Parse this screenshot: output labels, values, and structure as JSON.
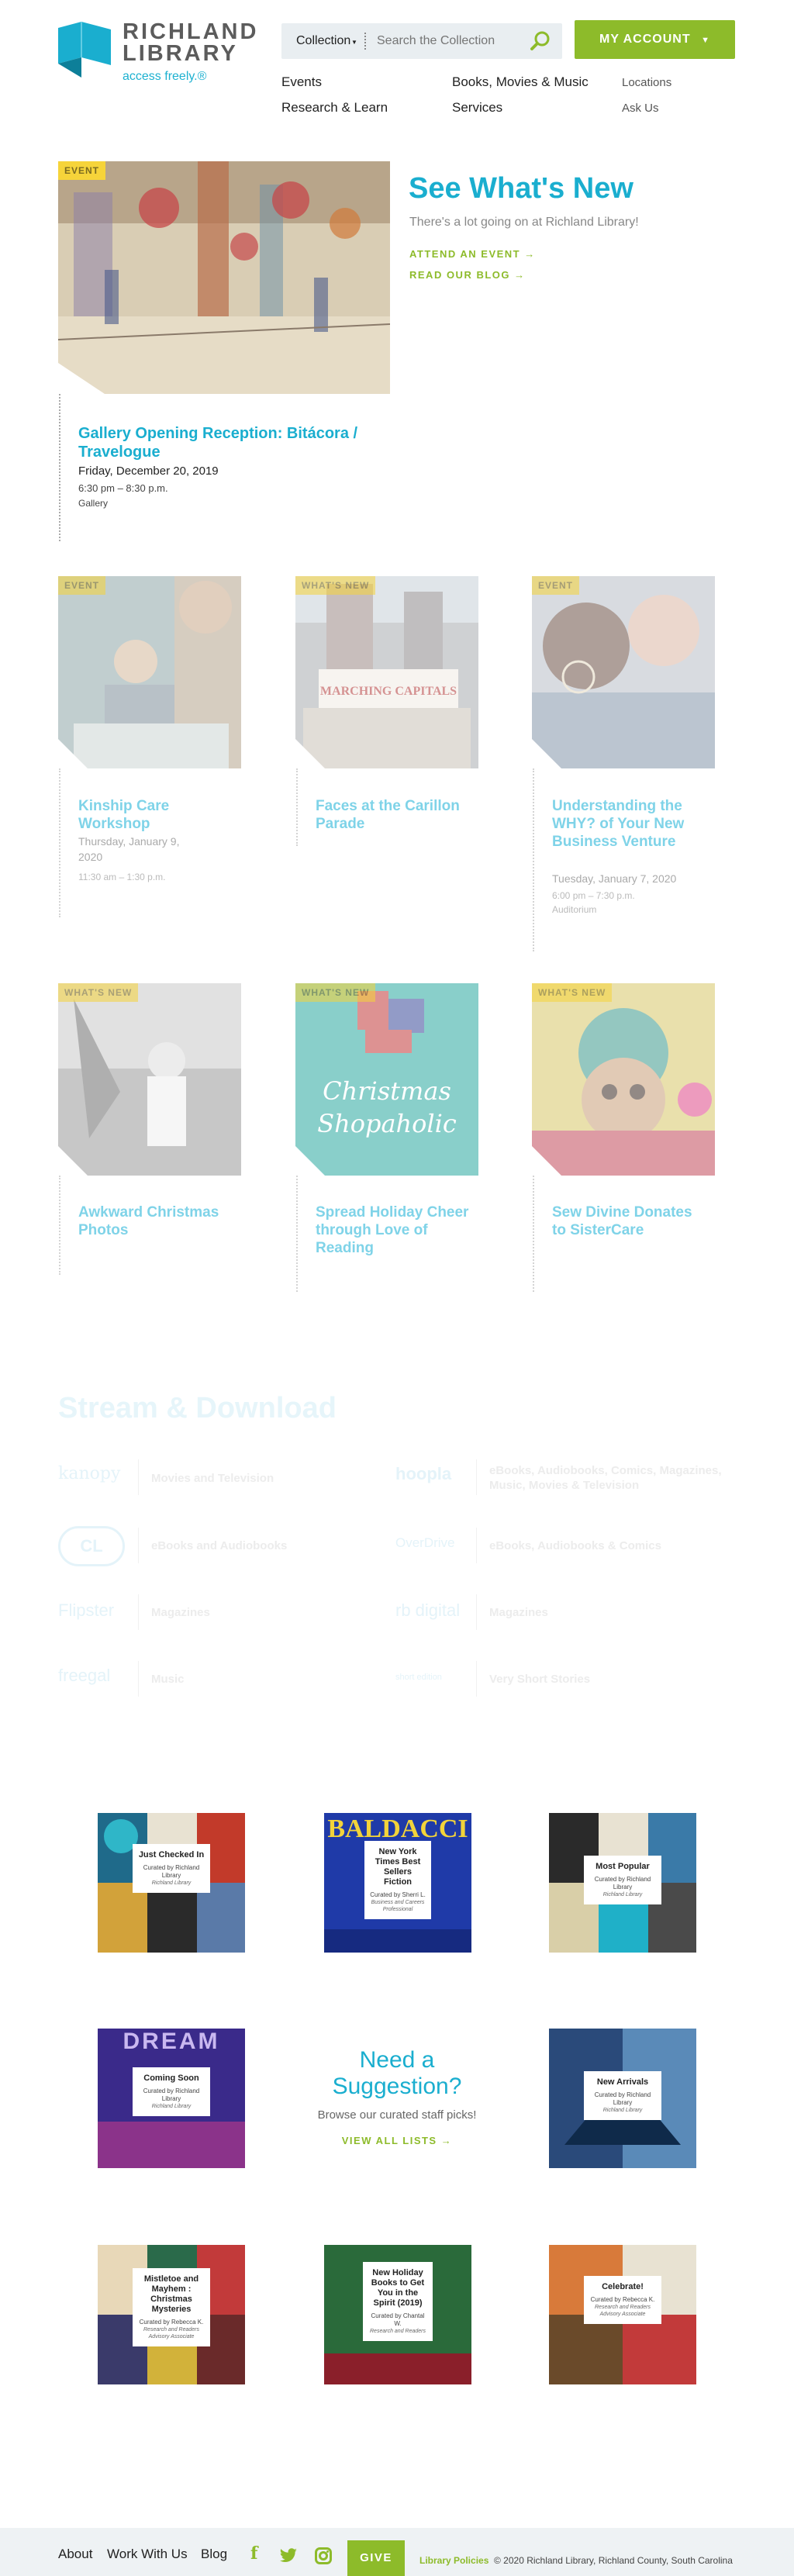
{
  "header": {
    "logo_line1": "RICHLAND",
    "logo_line2": "LIBRARY",
    "tagline": "access freely.®",
    "search_scope": "Collection",
    "search_placeholder": "Search the Collection",
    "account_label": "MY ACCOUNT",
    "nav": {
      "events": "Events",
      "books": "Books, Movies & Music",
      "locations": "Locations",
      "research": "Research & Learn",
      "services": "Services",
      "ask": "Ask Us"
    }
  },
  "featured": {
    "tag": "EVENT",
    "title": "Gallery Opening Reception: Bitácora / Travelogue",
    "date": "Friday, December 20, 2019",
    "time": "6:30 pm – 8:30 p.m.",
    "location": "Gallery"
  },
  "see_whats_new": {
    "title": "See What's New",
    "subtitle": "There's a lot going on at Richland Library!",
    "link1": "ATTEND AN EVENT →",
    "link2": "READ OUR BLOG →"
  },
  "cards_row1": [
    {
      "tag": "EVENT",
      "title": "Kinship Care Workshop",
      "date": "Thursday, January 9, 2020",
      "time": "11:30 am – 1:30 p.m.",
      "location": ""
    },
    {
      "tag": "WHAT'S NEW",
      "title": "Faces at the Carillon Parade",
      "date": "",
      "time": "",
      "location": ""
    },
    {
      "tag": "EVENT",
      "title": "Understanding the WHY? of Your New Business Venture",
      "date": "Tuesday, January 7, 2020",
      "time": "6:00 pm – 7:30 p.m.",
      "location": "Auditorium"
    }
  ],
  "cards_row2": [
    {
      "tag": "WHAT'S NEW",
      "title": "Awkward Christmas Photos"
    },
    {
      "tag": "WHAT'S NEW",
      "title": "Spread Holiday Cheer through Love of Reading",
      "image_text1": "Christmas",
      "image_text2": "Shopaholic"
    },
    {
      "tag": "WHAT'S NEW",
      "title": "Sew Divine Donates to SisterCare"
    }
  ],
  "parade_banner": "MARCHING CAPITALS",
  "stream": {
    "title": "Stream & Download",
    "items": [
      {
        "logo": "kanopy",
        "label": "Movies and Television"
      },
      {
        "logo": "hoopla",
        "label": "eBooks, Audiobooks, Comics, Magazines, Music, Movies & Television"
      },
      {
        "logo": "CL",
        "label": "eBooks and Audiobooks"
      },
      {
        "logo": "OverDrive",
        "label": "eBooks, Audiobooks & Comics"
      },
      {
        "logo": "Flipster",
        "label": "Magazines"
      },
      {
        "logo": "rb digital",
        "label": "Magazines"
      },
      {
        "logo": "freegal",
        "label": "Music"
      },
      {
        "logo": "short edition",
        "label": "Very Short Stories"
      }
    ]
  },
  "lists": {
    "suggest_title": "Need a Suggestion?",
    "suggest_sub": "Browse our curated staff picks!",
    "suggest_link": "VIEW ALL LISTS →",
    "books": [
      {
        "title": "Just Checked In",
        "curator": "Curated by Richland Library",
        "sub": "Richland Library"
      },
      {
        "title": "New York Times Best Sellers Fiction",
        "curator": "Curated by Sherri L.",
        "sub": "Business and Careers Professional",
        "cover": "BALDACCI"
      },
      {
        "title": "Most Popular",
        "curator": "Curated by Richland Library",
        "sub": "Richland Library"
      },
      {
        "title": "Coming Soon",
        "curator": "Curated by Richland Library",
        "sub": "Richland Library",
        "cover": "DREAM"
      },
      {
        "title": "New Arrivals",
        "curator": "Curated by Richland Library",
        "sub": "Richland Library"
      },
      {
        "title": "Mistletoe and Mayhem : Christmas Mysteries",
        "curator": "Curated by Rebecca K.",
        "sub": "Research and Readers Advisory Associate"
      },
      {
        "title": "New Holiday Books to Get You in the Spirit (2019)",
        "curator": "Curated by Chantal W.",
        "sub": "Research and Readers"
      },
      {
        "title": "Celebrate!",
        "curator": "Curated by Rebecca K.",
        "sub": "Research and Readers Advisory Associate"
      }
    ]
  },
  "footer": {
    "about": "About",
    "work": "Work With Us",
    "blog": "Blog",
    "give": "GIVE",
    "policies": "Library Policies",
    "copyright": "© 2020 Richland Library, Richland County, South Carolina"
  },
  "colors": {
    "brand_blue": "#1aaecf",
    "brand_green": "#8dbb2a",
    "tag_yellow": "#f6d43a"
  }
}
